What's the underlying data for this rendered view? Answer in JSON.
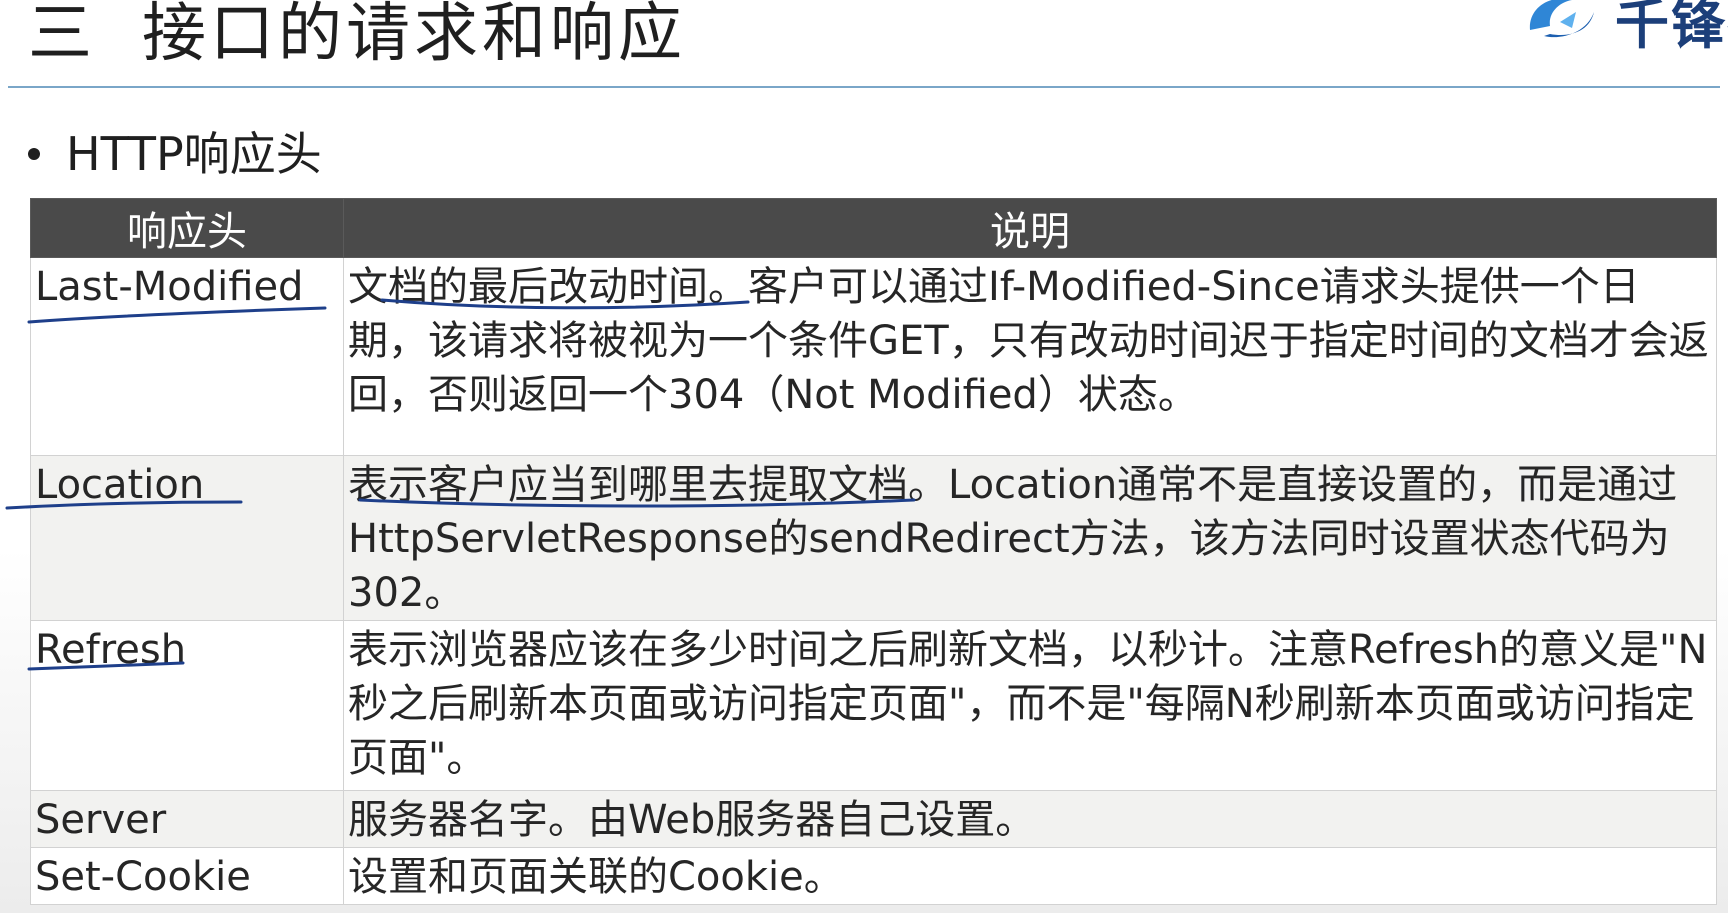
{
  "slide": {
    "title_number": "三",
    "title_text": "接口的请求和响应",
    "logo_text": "千锋教",
    "bullet": "HTTP响应头"
  },
  "table": {
    "headers": [
      "响应头",
      "说明"
    ],
    "rows": [
      {
        "name": "Last-Modified",
        "desc": "文档的最后改动时间。客户可以通过If-Modified-Since请求头提供一个日期，该请求将被视为一个条件GET，只有改动时间迟于指定时间的文档才会返回，否则返回一个304（Not Modified）状态。"
      },
      {
        "name": "Location",
        "desc": "表示客户应当到哪里去提取文档。Location通常不是直接设置的，而是通过HttpServletResponse的sendRedirect方法，该方法同时设置状态代码为302。"
      },
      {
        "name": "Refresh",
        "desc": "表示浏览器应该在多少时间之后刷新文档，以秒计。注意Refresh的意义是\"N秒之后刷新本页面或访问指定页面\"，而不是\"每隔N秒刷新本页面或访问指定页面\"。"
      },
      {
        "name": "Server",
        "desc": "服务器名字。由Web服务器自己设置。"
      },
      {
        "name": "Set-Cookie",
        "desc": "设置和页面关联的Cookie。"
      }
    ]
  },
  "colors": {
    "header_bg": "#4a4a4a",
    "title_rule": "#7aa6c8",
    "pen_ink": "#1e3f8a",
    "logo_blue": "#2f86d6"
  }
}
